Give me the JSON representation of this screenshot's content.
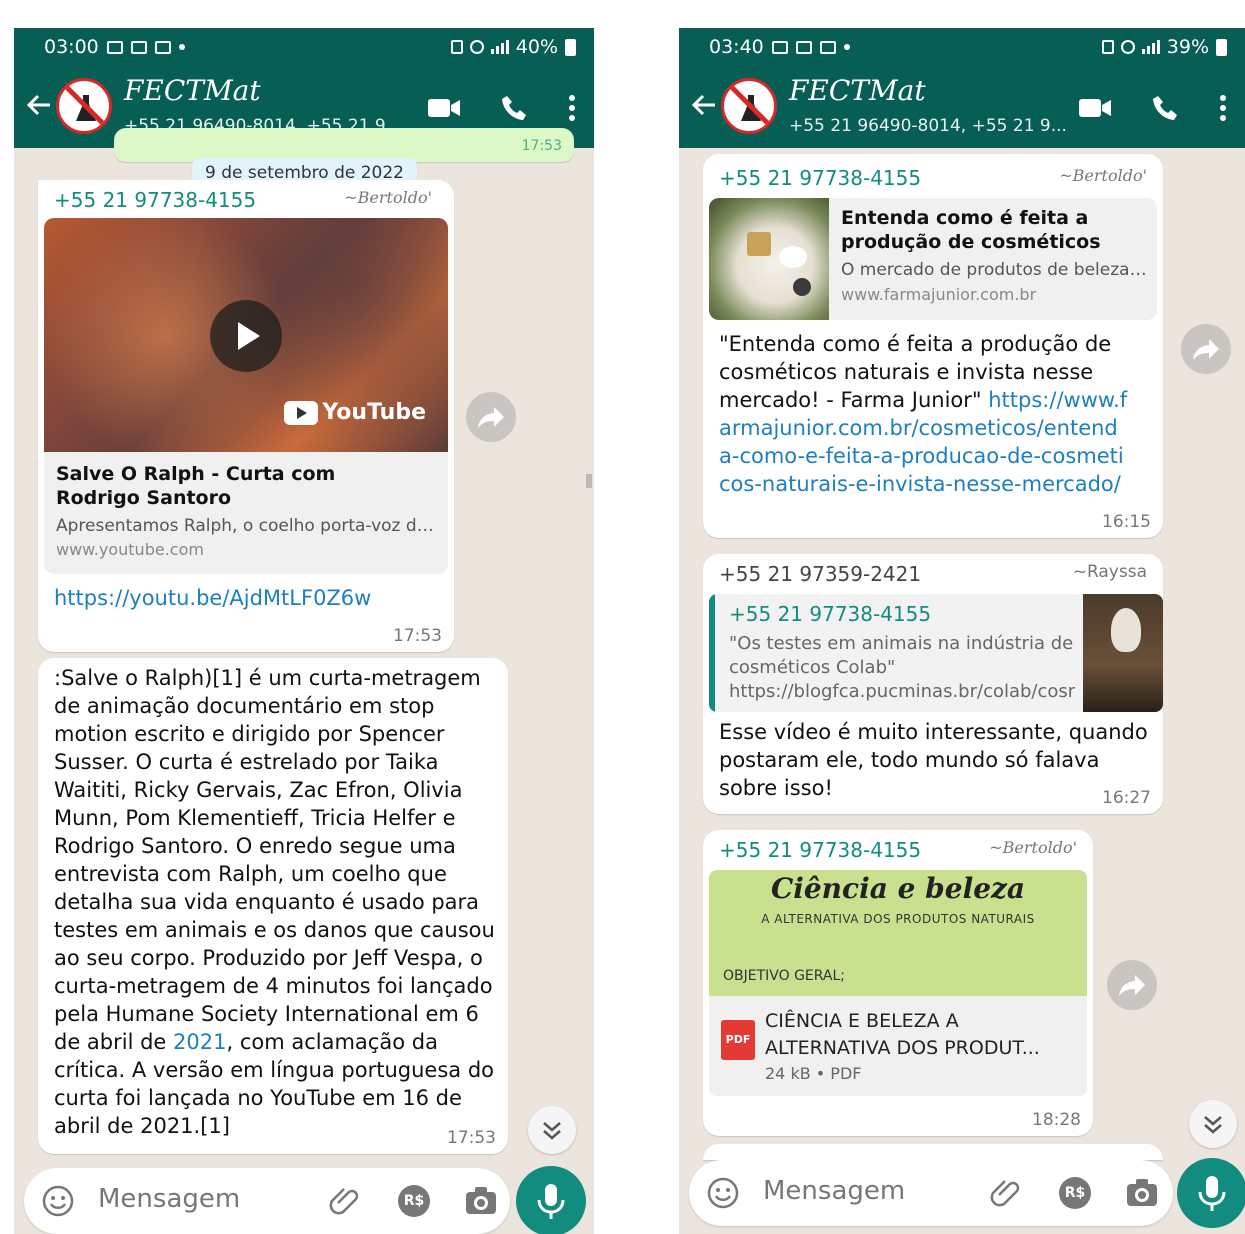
{
  "left": {
    "status": {
      "time": "03:00",
      "battery": "40%"
    },
    "header": {
      "title": "FECTMat",
      "subtitle": "+55 21 96490-8014, +55 21 9..."
    },
    "date_chip": "9 de setembro de 2022",
    "peek_time": "17:53",
    "msg1": {
      "sender": "+55 21 97738-4155",
      "pushname": "~Bertoldo'",
      "video_brand": "YouTube",
      "preview_title": "Salve O Ralph - Curta com Rodrigo Santoro",
      "preview_desc": "Apresentamos Ralph, o coelho porta-voz da ...",
      "preview_domain": "www.youtube.com",
      "link": "https://youtu.be/AjdMtLF0Z6w",
      "time": "17:53"
    },
    "msg2": {
      "text_pre": ":Salve o Ralph)[1] é um curta-metragem de animação documentário em stop motion escrito e dirigido por Spencer Susser. O curta é estrelado por Taika Waititi, Ricky Gervais, Zac Efron, Olivia Munn, Pom Klementieff, Tricia Helfer e Rodrigo Santoro. O enredo segue uma entrevista com Ralph, um coelho que detalha sua vida enquanto é usado para testes em animais e os danos que causou ao seu corpo. Produzido por Jeff Vespa, o curta-metragem de 4 minutos foi lançado pela Humane Society International em 6 de abril de ",
      "text_link": "2021",
      "text_post": ", com aclamação da crítica. A versão em língua portuguesa do curta foi lançada no YouTube em 16 de abril de 2021.[1]",
      "time": "17:53"
    },
    "input": {
      "placeholder": "Mensagem"
    }
  },
  "right": {
    "status": {
      "time": "03:40",
      "battery": "39%"
    },
    "header": {
      "title": "FECTMat",
      "subtitle": "+55 21 96490-8014, +55 21 9..."
    },
    "msg1": {
      "sender": "+55 21 97738-4155",
      "pushname": "~Bertoldo'",
      "preview_title": "Entenda como é feita a produção de cosméticos naturais e invist...",
      "preview_desc": "O mercado de produtos de beleza é ...",
      "preview_domain": "www.farmajunior.com.br",
      "text": "\"Entenda como é feita a produção de cosméticos naturais e invista nesse mercado! - Farma Junior\" ",
      "link": "https://www.farmajunior.com.br/cosmeticos/entenda-como-e-feita-a-producao-de-cosmeticos-naturais-e-invista-nesse-mercado/",
      "time": "16:15"
    },
    "msg2": {
      "sender": "+55 21 97359-2421",
      "pushname": "~Rayssa",
      "quote_sender": "+55 21 97738-4155",
      "quote_text": "\"Os testes em animais na indústria de cosméticos Colab\" https://blogfca.pucminas.br/colab/cosmeticos-ani...",
      "text": "Esse vídeo é muito interessante, quando postaram ele, todo mundo só falava sobre isso!",
      "time": "16:27"
    },
    "msg3": {
      "sender": "+55 21 97738-4155",
      "pushname": "~Bertoldo'",
      "doc_title": "Ciência e beleza",
      "doc_subtitle": "A ALTERNATIVA DOS PRODUTOS NATURAIS",
      "doc_note": "OBJETIVO GERAL;",
      "file_name": "CIÊNCIA E BELEZA A ALTERNATIVA DOS PRODUT...",
      "file_meta": "24 kB • PDF",
      "pdf_label": "PDF",
      "time": "18:28"
    },
    "input": {
      "placeholder": "Mensagem"
    }
  },
  "icons": {
    "currency_badge": "R$"
  },
  "colors": {
    "header": "#075e54",
    "accent": "#128c7e",
    "chat_bg": "#ece5dd",
    "link": "#1c7fc4"
  }
}
